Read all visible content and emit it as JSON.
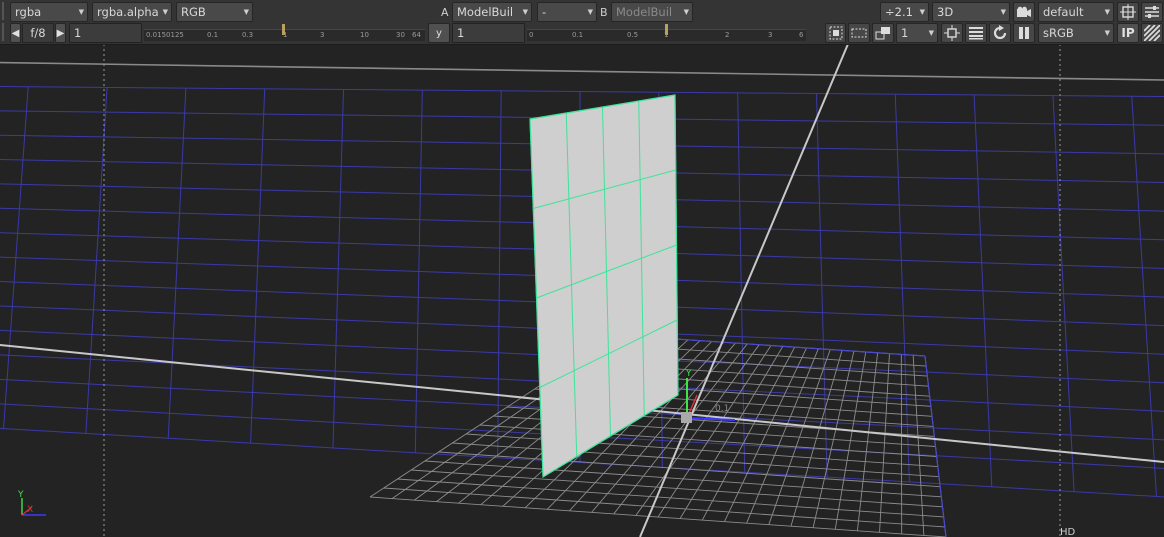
{
  "toolbar": {
    "channels": "rgba",
    "alpha_channel": "rgba.alpha",
    "display_channel": "RGB",
    "a_label": "A",
    "a_input": "ModelBuil",
    "compare_mode": "-",
    "b_label": "B",
    "b_input": "ModelBuil",
    "gain_value": "÷2.1",
    "view_mode": "3D",
    "camera": "default",
    "fstop": "f/8",
    "frame_value": "1",
    "gamma_label": "y",
    "gamma_value": "1",
    "proxy_scale": "1",
    "lut": "sRGB",
    "ip_label": "IP",
    "gain_ruler": [
      "0.0150125",
      "0.1",
      "0.3",
      "1",
      "3",
      "10",
      "30",
      "64"
    ],
    "gamma_ruler": [
      "0",
      "0.1",
      "0.5",
      "1",
      "2",
      "3",
      "6"
    ]
  },
  "viewport": {
    "axis_y_label": "Y",
    "axis_x_label": "X",
    "gizmo_y_label": "Y",
    "gizmo_value": "0.1",
    "format_label": "HD"
  },
  "colors": {
    "background": "#232323",
    "grid_blue": "#3a3aa8",
    "horizon": "#c8c8c8",
    "card_face": "#cfcfcf",
    "card_wire": "#3fe39a"
  },
  "icons": [
    "gain-dropdown-icon",
    "camera-icon",
    "roi-icon",
    "checker-icon",
    "region-icon",
    "proxy-icon",
    "render-icon",
    "lines-icon",
    "refresh-icon",
    "pause-icon",
    "wipe-icon",
    "stripe-icon"
  ]
}
